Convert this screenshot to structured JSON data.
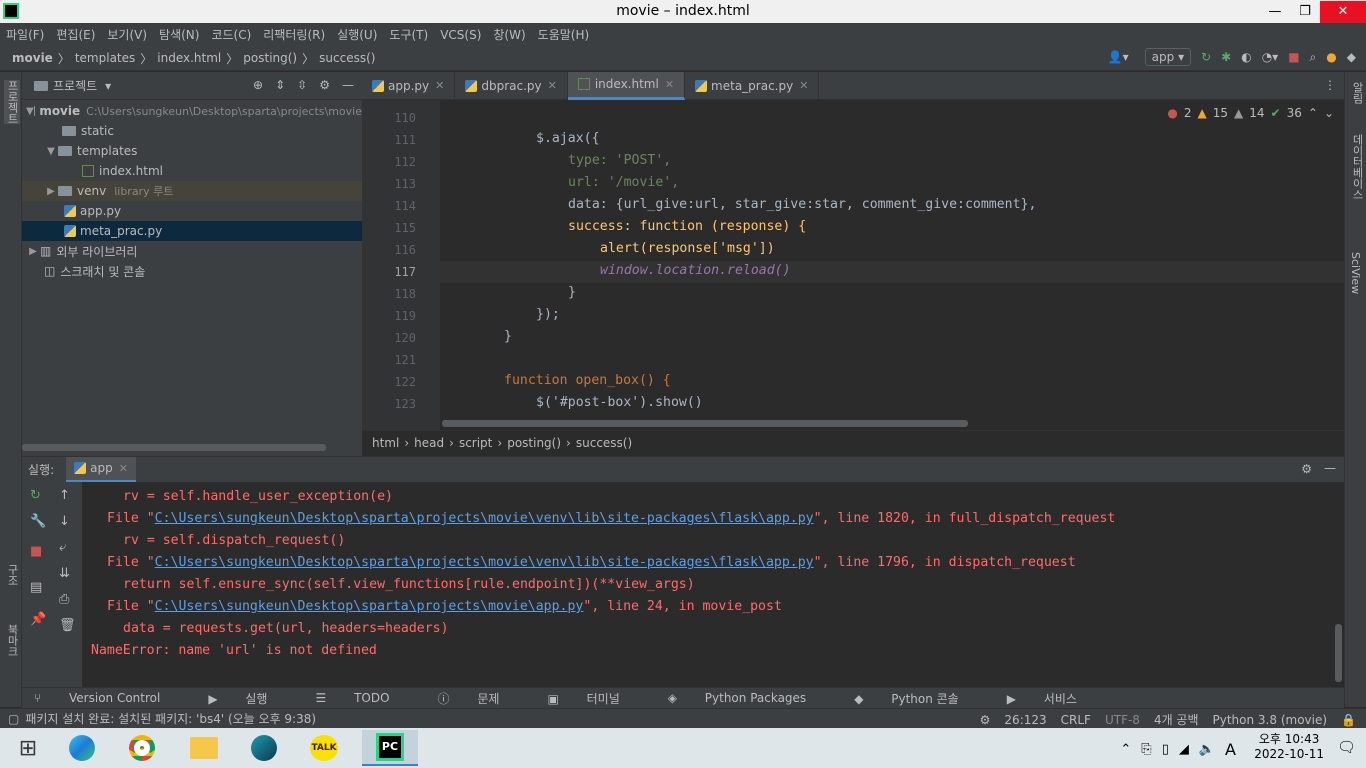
{
  "window": {
    "title": "movie – index.html",
    "minimize": "—",
    "maximize": "❐",
    "close": "✕"
  },
  "menu": [
    "파일(F)",
    "편집(E)",
    "보기(V)",
    "탐색(N)",
    "코드(C)",
    "리팩터링(R)",
    "실행(U)",
    "도구(T)",
    "VCS(S)",
    "창(W)",
    "도움말(H)"
  ],
  "nav": {
    "items": [
      "movie",
      "templates",
      "index.html",
      "posting()",
      "success()"
    ],
    "run_config": "app"
  },
  "left_strip": {
    "top": "프로젝트",
    "mid": "구조",
    "bottom": "북마크"
  },
  "right_strip": {
    "top": "알림",
    "mid": "데이터베이스",
    "bottom": "SciView"
  },
  "project": {
    "title": "프로젝트",
    "tree": [
      {
        "label": "movie",
        "path": "C:\\Users\\sungkeun\\Desktop\\sparta\\projects\\movie"
      },
      {
        "label": "static"
      },
      {
        "label": "templates"
      },
      {
        "label": "index.html"
      },
      {
        "label": "venv",
        "hint": "library 루트"
      },
      {
        "label": "app.py"
      },
      {
        "label": "meta_prac.py"
      },
      {
        "label": "외부 라이브러리"
      },
      {
        "label": "스크래치 및 콘솔"
      }
    ]
  },
  "tabs": [
    {
      "label": "app.py"
    },
    {
      "label": "dbprac.py"
    },
    {
      "label": "index.html"
    },
    {
      "label": "meta_prac.py"
    }
  ],
  "inspections": {
    "errors": "2",
    "warnings": "15",
    "weak": "14",
    "ok": "36"
  },
  "editor": {
    "lines": [
      {
        "n": "110",
        "code": ""
      },
      {
        "n": "111",
        "code": "$.ajax({"
      },
      {
        "n": "112",
        "code": "type: 'POST',"
      },
      {
        "n": "113",
        "code": "url: '/movie',"
      },
      {
        "n": "114",
        "code": "data: {url_give:url, star_give:star, comment_give:comment},"
      },
      {
        "n": "115",
        "code": "success: function (response) {"
      },
      {
        "n": "116",
        "code": "alert(response['msg'])"
      },
      {
        "n": "117",
        "code": "window.location.reload()"
      },
      {
        "n": "118",
        "code": "}"
      },
      {
        "n": "119",
        "code": "});"
      },
      {
        "n": "120",
        "code": "}"
      },
      {
        "n": "121",
        "code": ""
      },
      {
        "n": "122",
        "code": "function open_box() {"
      },
      {
        "n": "123",
        "code": "$('#post-box').show()"
      }
    ]
  },
  "breadcrumb": [
    "html",
    "head",
    "script",
    "posting()",
    "success()"
  ],
  "run": {
    "label": "실행:",
    "tab": "app",
    "console": [
      "rv = self.handle_user_exception(e)",
      "File \"",
      "C:\\Users\\sungkeun\\Desktop\\sparta\\projects\\movie\\venv\\lib\\site-packages\\flask\\app.py",
      "\", line 1820, in full_dispatch_request",
      "rv = self.dispatch_request()",
      "\", line 1796, in dispatch_request",
      "return self.ensure_sync(self.view_functions[rule.endpoint])(**view_args)",
      "C:\\Users\\sungkeun\\Desktop\\sparta\\projects\\movie\\app.py",
      "\", line 24, in movie_post",
      "data = requests.get(url, headers=headers)",
      "NameError: name 'url' is not defined"
    ]
  },
  "toolwindows": [
    "Version Control",
    "실행",
    "TODO",
    "문제",
    "터미널",
    "Python Packages",
    "Python 콘솔",
    "서비스"
  ],
  "status": {
    "message": "패키지 설치 완료: 설치된 패키지: 'bs4' (오늘 오후 9:38)",
    "position": "26:123",
    "line_sep": "CRLF",
    "encoding": "UTF-8",
    "indent": "4개 공백",
    "interpreter": "Python 3.8 (movie)"
  },
  "taskbar": {
    "time": "오후 10:43",
    "date": "2022-10-11",
    "ime": "A"
  }
}
